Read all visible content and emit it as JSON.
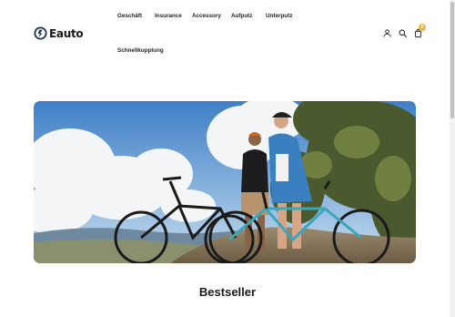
{
  "brand": {
    "name": "Eauto",
    "logo_icon": "eauto-logo-icon"
  },
  "nav": {
    "items": [
      {
        "label": "Geschäft"
      },
      {
        "label": "Insurance"
      },
      {
        "label": "Accessory"
      },
      {
        "label": "Aufputz"
      },
      {
        "label": "Unterputz"
      },
      {
        "label": "Schnellkupplung"
      }
    ]
  },
  "header_icons": {
    "account": "user-icon",
    "search": "search-icon",
    "cart": "shopping-bag-icon",
    "cart_count": "0",
    "badge_color": "#f0b33c"
  },
  "hero": {
    "image": "two cyclists with e-mountain bikes on a hilltop"
  },
  "sections": {
    "bestseller_title": "Bestseller"
  }
}
